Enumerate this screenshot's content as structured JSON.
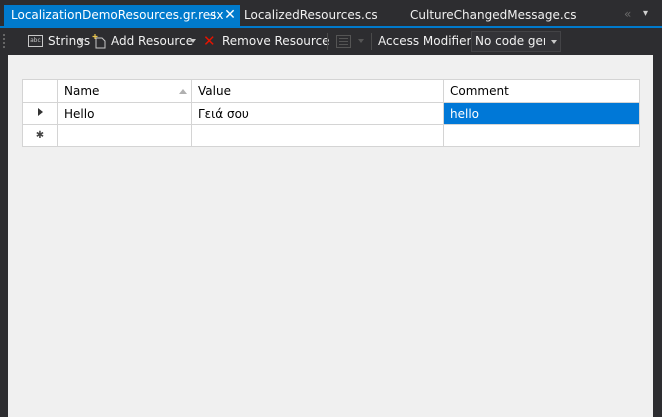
{
  "tabs": [
    {
      "label": "LocalizationDemoResources.gr.resx",
      "active": true
    },
    {
      "label": "LocalizedResources.cs",
      "active": false
    },
    {
      "label": "CultureChangedMessage.cs",
      "active": false
    }
  ],
  "tab_controls": {
    "pin": "⊣",
    "close": "✕",
    "overflow": "«",
    "dropdown": "▾"
  },
  "toolbar": {
    "strings_label": "Strings",
    "strings_icon_text": "abc",
    "add_resource_label": "Add Resource",
    "remove_resource_label": "Remove Resource",
    "access_modifier_label": "Access Modifier:",
    "access_modifier_value": "No code generation"
  },
  "grid": {
    "columns": [
      "Name",
      "Value",
      "Comment"
    ],
    "rows": [
      {
        "name": "Hello",
        "value": "Γειά σου",
        "comment": "hello"
      }
    ],
    "new_row_marker": "✱"
  },
  "colors": {
    "accent": "#007acc",
    "selection": "#0078d7",
    "remove_icon": "#e51400",
    "chrome_bg": "#2d2d30",
    "surface_bg": "#f0f0f0"
  },
  "icons": [
    "strings-icon",
    "add-resource-icon",
    "remove-icon",
    "view-icon",
    "pin-icon",
    "close-icon",
    "overflow-icon",
    "dropdown-icon"
  ]
}
